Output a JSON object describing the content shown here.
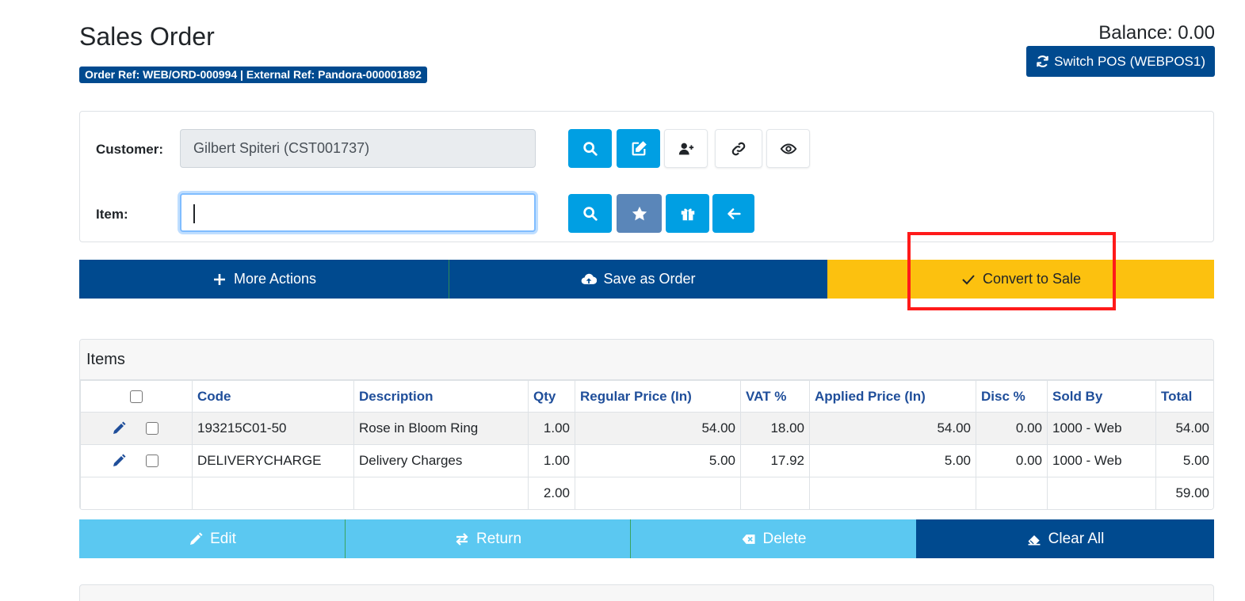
{
  "header": {
    "title": "Sales Order",
    "ref_badge": "Order Ref: WEB/ORD-000994 | External Ref: Pandora-000001892",
    "balance": "Balance: 0.00",
    "switch_pos_label": "Switch POS (WEBPOS1)"
  },
  "form": {
    "customer_label": "Customer:",
    "customer_value": "Gilbert Spiteri (CST001737)",
    "item_label": "Item:",
    "item_value": "",
    "customer_buttons": [
      "search-icon",
      "edit-icon",
      "add-user-icon",
      "link-icon",
      "eye-icon"
    ],
    "item_buttons": [
      "search-icon",
      "star-icon",
      "gift-icon",
      "arrow-left-icon"
    ]
  },
  "actions": {
    "more_actions": "More Actions",
    "save_as_order": "Save as Order",
    "convert_to_sale": "Convert to Sale"
  },
  "items": {
    "title": "Items",
    "columns": [
      "Code",
      "Description",
      "Qty",
      "Regular Price (In)",
      "VAT %",
      "Applied Price (In)",
      "Disc %",
      "Sold By",
      "Total"
    ],
    "rows": [
      {
        "code": "193215C01-50",
        "description": "Rose in Bloom Ring",
        "qty": "1.00",
        "regular_price": "54.00",
        "vat": "18.00",
        "applied_price": "54.00",
        "disc": "0.00",
        "sold_by": "1000 - Web",
        "total": "54.00"
      },
      {
        "code": "DELIVERYCHARGE",
        "description": "Delivery Charges",
        "qty": "1.00",
        "regular_price": "5.00",
        "vat": "17.92",
        "applied_price": "5.00",
        "disc": "0.00",
        "sold_by": "1000 - Web",
        "total": "5.00"
      }
    ],
    "totals": {
      "qty": "2.00",
      "total": "59.00"
    }
  },
  "bottom_actions": {
    "edit": "Edit",
    "return": "Return",
    "delete": "Delete",
    "clear_all": "Clear All"
  },
  "colors": {
    "primary_dark": "#004a8f",
    "accent_blue": "#009fe3",
    "light_blue": "#5bc8f1",
    "warning": "#fcc10f",
    "highlight": "#ff1a1a"
  }
}
